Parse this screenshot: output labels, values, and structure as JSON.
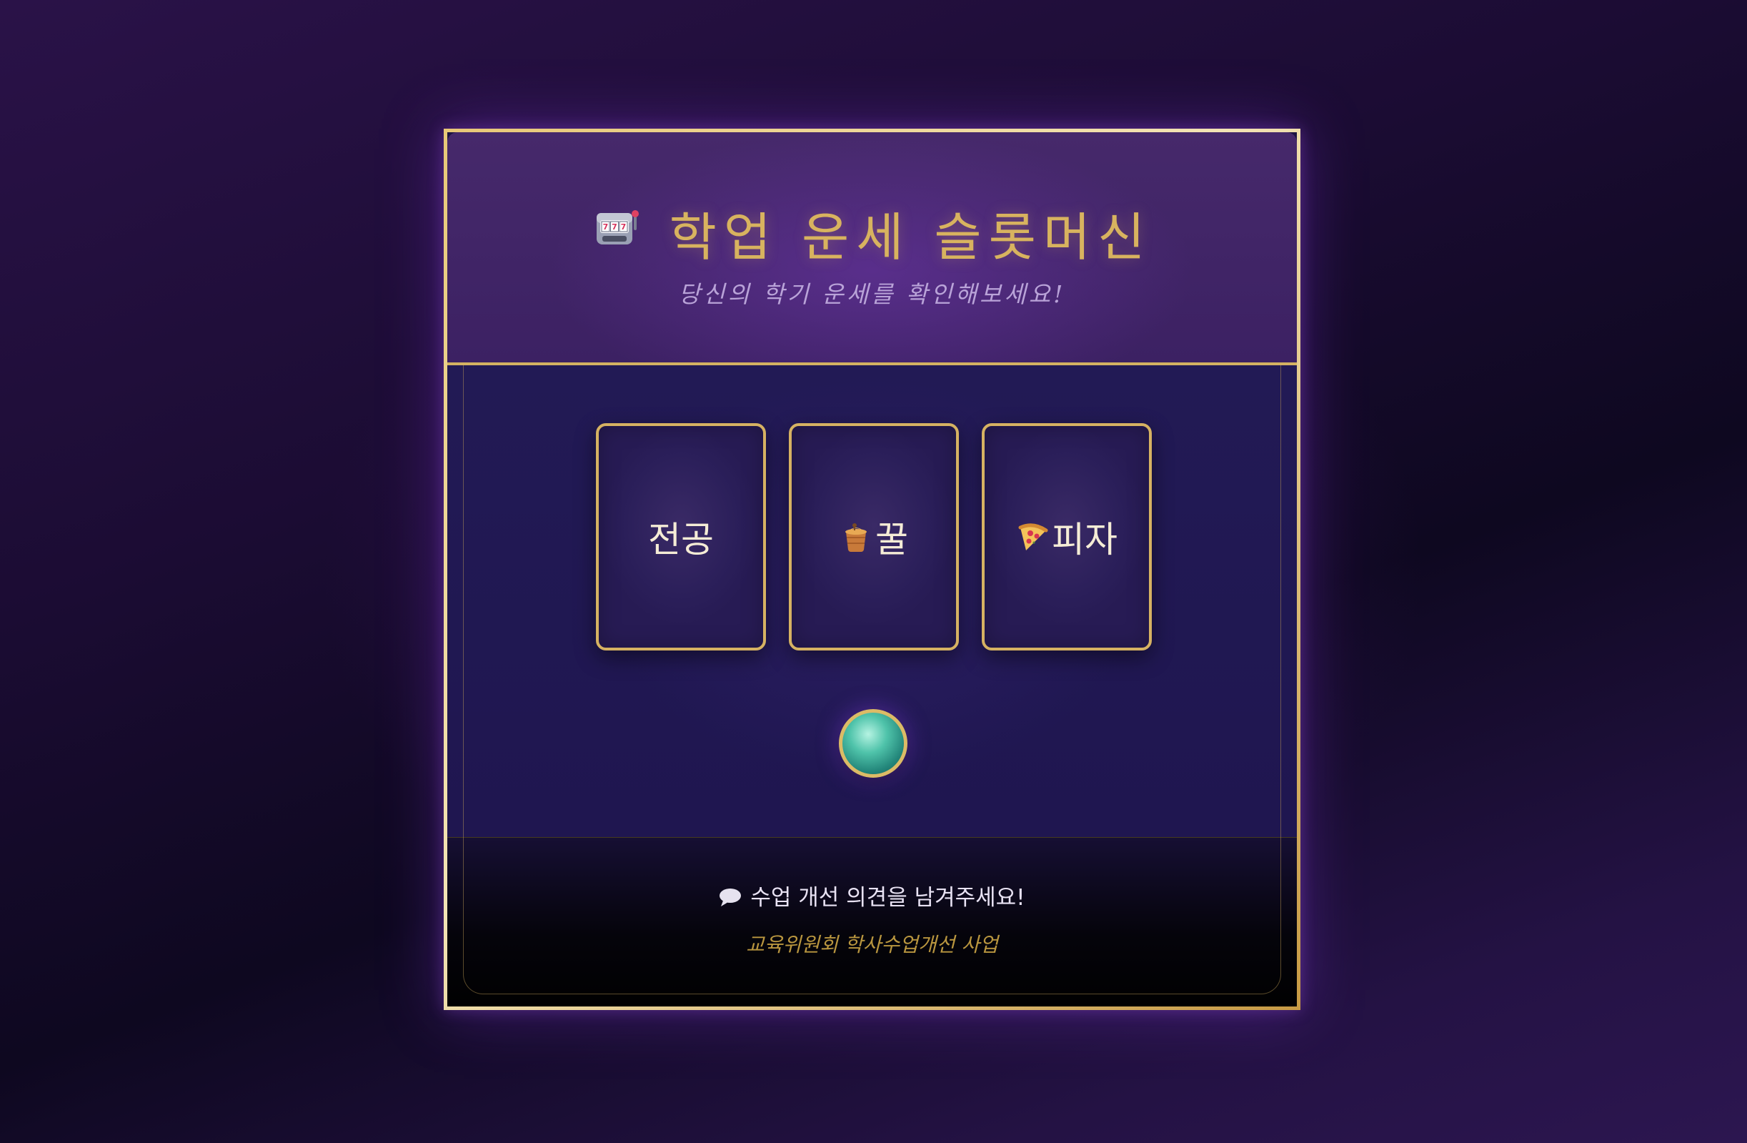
{
  "header": {
    "icon": "slot-machine-icon",
    "title": "학업 운세 슬롯머신",
    "subtitle": "당신의 학기 운세를 확인해보세요!"
  },
  "reels": [
    {
      "label": "전공",
      "icon": null
    },
    {
      "label": "꿀",
      "icon": "honey-pot-icon"
    },
    {
      "label": "피자",
      "icon": "pizza-icon"
    }
  ],
  "spin_button": {
    "icon": "teal-orb-button"
  },
  "footer": {
    "icon": "speech-bubble-icon",
    "feedback_text": "수업 개선 의견을 남겨주세요!",
    "credit": "교육위원회 학사수업개선 사업"
  },
  "colors": {
    "gold": "#d6b262",
    "title_gold": "#d8b35f",
    "header_purple": "#46296b",
    "body_navy": "#221a55",
    "orb_teal": "#4fc3aa",
    "subtitle_lavender": "#b9a3d8"
  }
}
